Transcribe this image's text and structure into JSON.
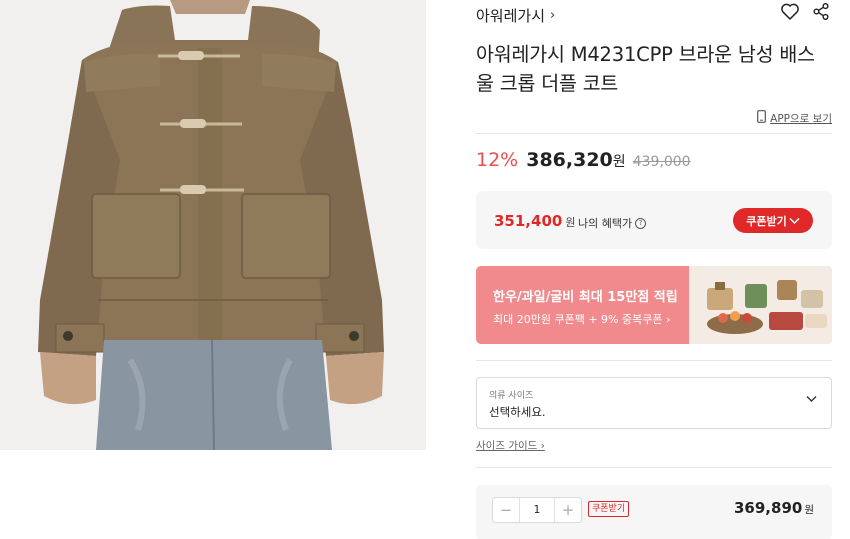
{
  "brand": {
    "name": "아워레가시",
    "chevron": "›"
  },
  "product": {
    "title": "아워레가시 M4231CPP 브라운 남성 배스 울 크롭 더플 코트"
  },
  "app_link": "APP으로 보기",
  "price": {
    "discount_rate": "12%",
    "sale_price": "386,320",
    "won": "원",
    "original_price": "439,000"
  },
  "benefit": {
    "price": "351,400",
    "won": "원",
    "label": "나의 혜택가",
    "coupon_button": "쿠폰받기"
  },
  "banner": {
    "title": "한우/과일/굴비 최대 15만점 적립",
    "subtitle": "최대 20만원 쿠폰팩 + 9% 중복쿠폰 ›"
  },
  "size_select": {
    "label": "의류 사이즈",
    "value": "선택하세요."
  },
  "size_guide": "사이즈 가이드 ›",
  "order": {
    "quantity": "1",
    "coupon_tag": "쿠폰받기",
    "total_price": "369,890",
    "won": "원"
  },
  "icons": {
    "brand_chevron": "chevron-right-icon",
    "wishlist": "heart-icon",
    "share": "share-icon",
    "app": "phone-icon",
    "info": "info-icon",
    "select": "chevron-down-icon"
  },
  "colors": {
    "accent": "#e02828",
    "discount": "#ee4d4d",
    "banner": "#f08a8d"
  }
}
